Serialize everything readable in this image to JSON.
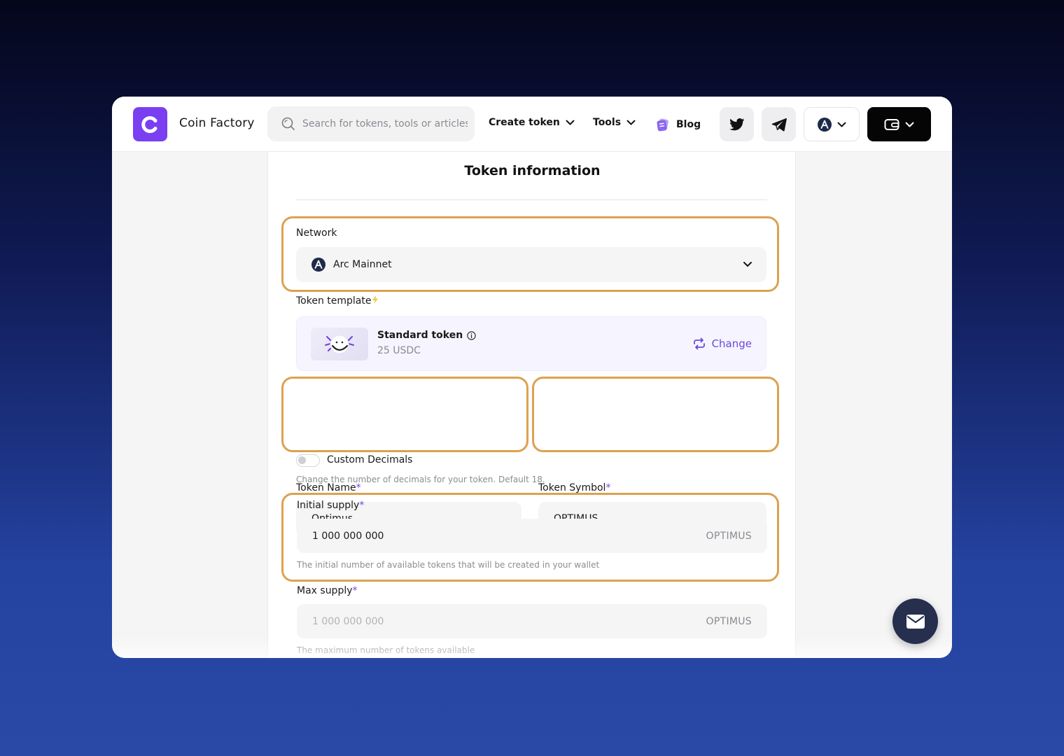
{
  "brand": {
    "name": "Coin Factory",
    "color": "#7b3ff2"
  },
  "search": {
    "placeholder": "Search for tokens, tools or articles"
  },
  "nav": {
    "create_token": "Create token",
    "tools": "Tools",
    "blog": "Blog"
  },
  "social": {
    "twitter": "twitter-icon",
    "telegram": "telegram-icon"
  },
  "form": {
    "title": "Token information",
    "network": {
      "label": "Network",
      "value": "Arc Mainnet"
    },
    "template": {
      "label": "Token template",
      "name": "Standard token",
      "price": "25 USDC",
      "change_label": "Change"
    },
    "token_name": {
      "label": "Token Name",
      "required": "*",
      "value": "Optimus"
    },
    "token_symbol": {
      "label": "Token Symbol",
      "required": "*",
      "value": "OPTIMUS"
    },
    "custom_decimals": {
      "label": "Custom Decimals",
      "enabled": false,
      "hint": "Change the number of decimals for your token. Default 18."
    },
    "initial_supply": {
      "label": "Initial supply",
      "required": "*",
      "value": "1 000 000 000",
      "suffix": "OPTIMUS",
      "hint": "The initial number of available tokens that will be created in your wallet"
    },
    "max_supply": {
      "label": "Max supply",
      "required": "*",
      "placeholder": "1 000 000 000",
      "suffix": "OPTIMUS",
      "hint": "The maximum number of tokens available"
    }
  },
  "colors": {
    "highlight": "#dca250",
    "accent": "#7b3ff2",
    "fab": "#272f4e"
  }
}
